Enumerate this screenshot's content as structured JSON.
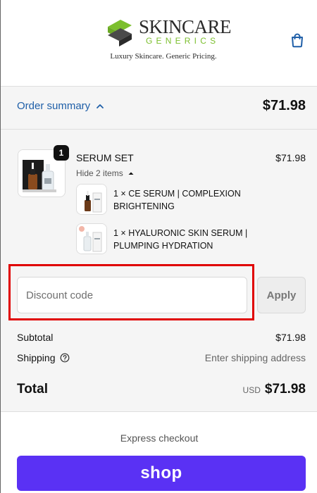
{
  "header": {
    "brand_word": "SKINCARE",
    "brand_sub": "GENERICS",
    "brand_tagline": "Luxury Skincare. Generic Pricing.",
    "icons": {
      "logo": "skincare-generics-logo",
      "cart": "shopping-bag-icon"
    },
    "colors": {
      "brand_green": "#7cbf2e",
      "brand_dark": "#2b2b2b"
    }
  },
  "summary": {
    "toggle_label": "Order summary",
    "total": "$71.98",
    "link_color": "#1f5fa8"
  },
  "cart": {
    "item": {
      "title": "SERUM SET",
      "price": "$71.98",
      "quantity": "1",
      "hide_label": "Hide 2 items"
    },
    "sub_items": [
      {
        "label": "1 × CE SERUM | COMPLEXION BRIGHTENING"
      },
      {
        "label": "1 × HYALURONIC SKIN SERUM | PLUMPING HYDRATION"
      }
    ]
  },
  "discount": {
    "placeholder": "Discount code",
    "apply_label": "Apply"
  },
  "totals": {
    "subtotal_label": "Subtotal",
    "subtotal_value": "$71.98",
    "shipping_label": "Shipping",
    "shipping_value": "Enter shipping address",
    "total_label": "Total",
    "total_currency": "USD",
    "total_value": "$71.98"
  },
  "express": {
    "title": "Express checkout",
    "shop_label": "shop",
    "shop_color": "#5a31f4"
  },
  "colors": {
    "highlight": "#e00000"
  }
}
